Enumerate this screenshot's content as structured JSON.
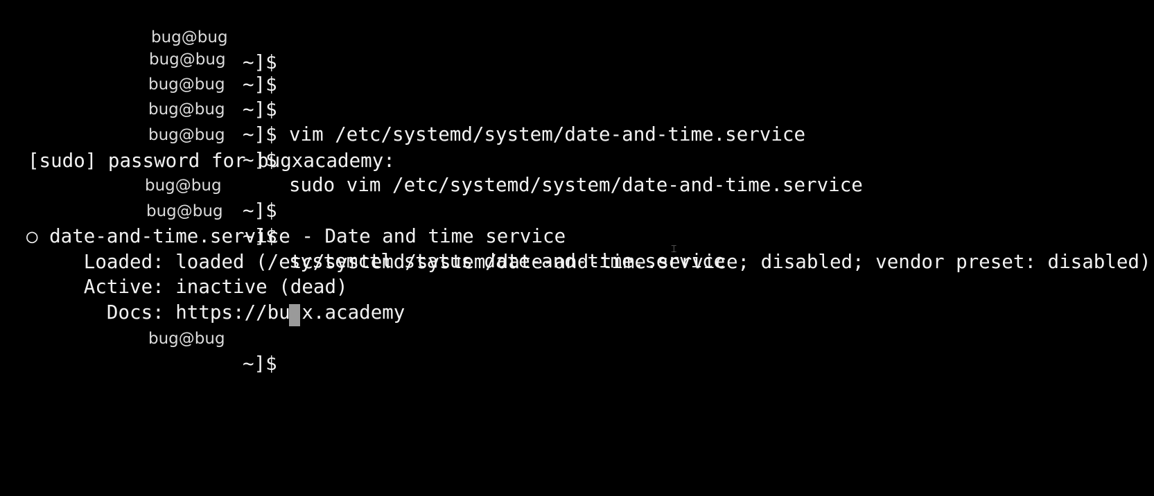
{
  "terminal": {
    "lines": [
      {
        "host": "bug@bug",
        "prompt": "~]$",
        "command": ""
      },
      {
        "host": "bug@bug",
        "prompt": "~]$",
        "command": ""
      },
      {
        "host": "bug@bug",
        "prompt": "~]$",
        "command": "vim /etc/systemd/system/date-and-time.service"
      },
      {
        "host": "bug@bug",
        "prompt": "~]$",
        "command": ""
      },
      {
        "host": "bug@bug",
        "prompt": "~]$",
        "command": "sudo vim /etc/systemd/system/date-and-time.service"
      },
      {
        "text": "[sudo] password for bugxacademy:"
      },
      {
        "host": "bug@bug",
        "prompt": "~]$",
        "command": ""
      },
      {
        "host": "bug@bug",
        "prompt": "~]$",
        "command": "systemctl status date-and-time.service"
      },
      {
        "text": "○ date-and-time.service - Date and time service"
      },
      {
        "text": "     Loaded: loaded (/etc/systemd/system/date-and-time.service; disabled; vendor preset: disabled)"
      },
      {
        "text": "     Active: inactive (dead)"
      },
      {
        "text": "       Docs: https://bugx.academy"
      },
      {
        "host": "bug@bug",
        "prompt": "~]$",
        "command": ""
      }
    ]
  },
  "colors": {
    "background": "#000000",
    "foreground": "#f2f2f2",
    "cursor": "#9a9a9a"
  },
  "icons": {
    "status_dot": "hollow-circle",
    "mouse_pointer": "ibeam-cursor"
  }
}
